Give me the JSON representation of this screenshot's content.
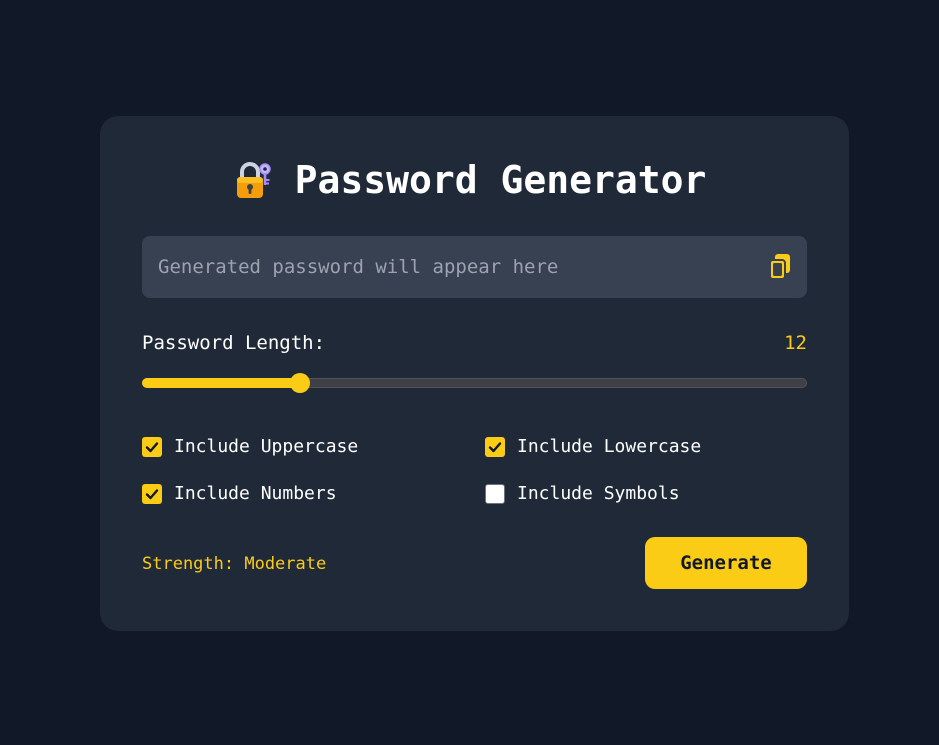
{
  "header": {
    "icon": "locked-with-key-icon",
    "title": "Password Generator"
  },
  "password": {
    "value": "",
    "placeholder": "Generated password will appear here",
    "copy_icon": "copy-icon"
  },
  "length": {
    "label": "Password Length:",
    "value": "12",
    "slider_fraction": 0.237
  },
  "options": [
    {
      "label": "Include Uppercase",
      "checked": true
    },
    {
      "label": "Include Lowercase",
      "checked": true
    },
    {
      "label": "Include Numbers",
      "checked": true
    },
    {
      "label": "Include Symbols",
      "checked": false
    }
  ],
  "strength": {
    "text": "Strength: Moderate"
  },
  "actions": {
    "generate_label": "Generate"
  },
  "colors": {
    "background": "#111827",
    "card": "#1f2937",
    "accent": "#facc15",
    "input_bg": "#374151"
  }
}
